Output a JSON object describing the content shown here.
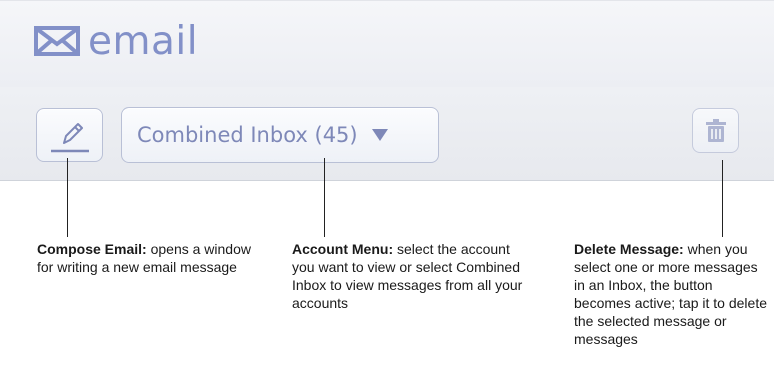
{
  "header": {
    "app_title": "email",
    "logo_icon": "envelope-icon",
    "title_color": "#8290c8"
  },
  "toolbar": {
    "compose_icon": "pencil-icon",
    "account_menu_label": "Combined Inbox (45)",
    "account_menu_icon": "caret-down-icon",
    "delete_icon": "trash-icon",
    "button_border_color": "#b9c0d6",
    "icon_color": "#7e88b8"
  },
  "callouts": {
    "compose": {
      "title": "Compose Email:",
      "text": "opens a window for writing a new email message"
    },
    "account": {
      "title": "Account Menu:",
      "text": "select the account you want to view or select Combined Inbox to view messages from all your accounts"
    },
    "delete": {
      "title": "Delete Message:",
      "text": "when you select one or more messages in an Inbox, the button becomes active; tap it to delete the selected message or messages"
    }
  }
}
